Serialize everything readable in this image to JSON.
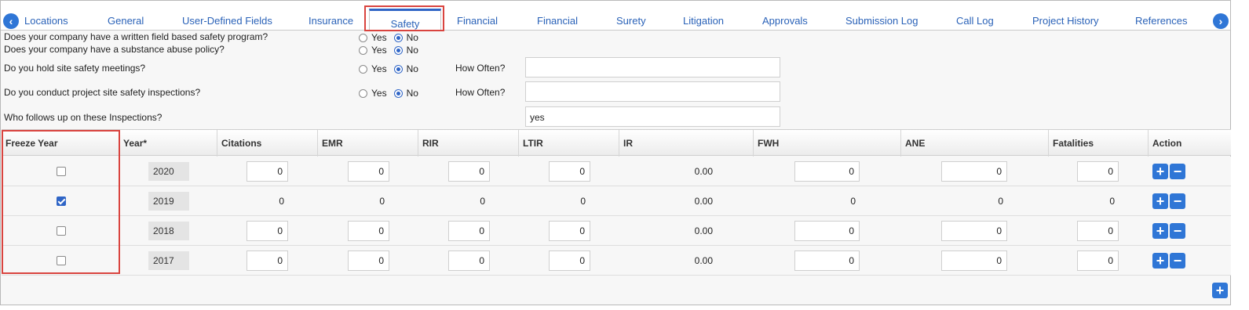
{
  "tabs": {
    "prev_icon": "chevron-left-icon",
    "next_icon": "chevron-right-icon",
    "items": [
      {
        "label": "Locations"
      },
      {
        "label": "General"
      },
      {
        "label": "User-Defined Fields"
      },
      {
        "label": "Insurance"
      },
      {
        "label": "Safety",
        "selected": true
      },
      {
        "label": "Financial"
      },
      {
        "label": "Financial"
      },
      {
        "label": "Surety"
      },
      {
        "label": "Litigation"
      },
      {
        "label": "Approvals"
      },
      {
        "label": "Submission Log"
      },
      {
        "label": "Call Log"
      },
      {
        "label": "Project History"
      },
      {
        "label": "References"
      }
    ]
  },
  "questions": [
    {
      "text": "Does your company have a written field based safety program?",
      "yes": "Yes",
      "no": "No",
      "answer": "No"
    },
    {
      "text": "Does your company have a substance abuse policy?",
      "yes": "Yes",
      "no": "No",
      "answer": "No"
    },
    {
      "text": "Do you hold site safety meetings?",
      "yes": "Yes",
      "no": "No",
      "answer": "No",
      "often_label": "How Often?",
      "often_value": ""
    },
    {
      "text": "Do you conduct project site safety inspections?",
      "yes": "Yes",
      "no": "No",
      "answer": "No",
      "often_label": "How Often?",
      "often_value": ""
    },
    {
      "text": "Who follows up on these Inspections?",
      "value": "yes"
    }
  ],
  "grid": {
    "columns": [
      "Freeze Year",
      "Year*",
      "Citations",
      "EMR",
      "RIR",
      "LTIR",
      "IR",
      "FWH",
      "ANE",
      "Fatalities",
      "Action"
    ],
    "rows": [
      {
        "frozen": false,
        "year": "2020",
        "citations": "0",
        "emr": "0",
        "rir": "0",
        "ltir": "0",
        "ir": "0.00",
        "fwh": "0",
        "ane": "0",
        "fatalities": "0"
      },
      {
        "frozen": true,
        "year": "2019",
        "citations": "0",
        "emr": "0",
        "rir": "0",
        "ltir": "0",
        "ir": "0.00",
        "fwh": "0",
        "ane": "0",
        "fatalities": "0"
      },
      {
        "frozen": false,
        "year": "2018",
        "citations": "0",
        "emr": "0",
        "rir": "0",
        "ltir": "0",
        "ir": "0.00",
        "fwh": "0",
        "ane": "0",
        "fatalities": "0"
      },
      {
        "frozen": false,
        "year": "2017",
        "citations": "0",
        "emr": "0",
        "rir": "0",
        "ltir": "0",
        "ir": "0.00",
        "fwh": "0",
        "ane": "0",
        "fatalities": "0"
      }
    ],
    "add_icon": "plus-icon",
    "remove_icon": "minus-icon",
    "add_row_icon": "plus-icon"
  },
  "colors": {
    "accent": "#2f76d6",
    "highlight": "#d9443f",
    "link": "#2a62b8"
  }
}
